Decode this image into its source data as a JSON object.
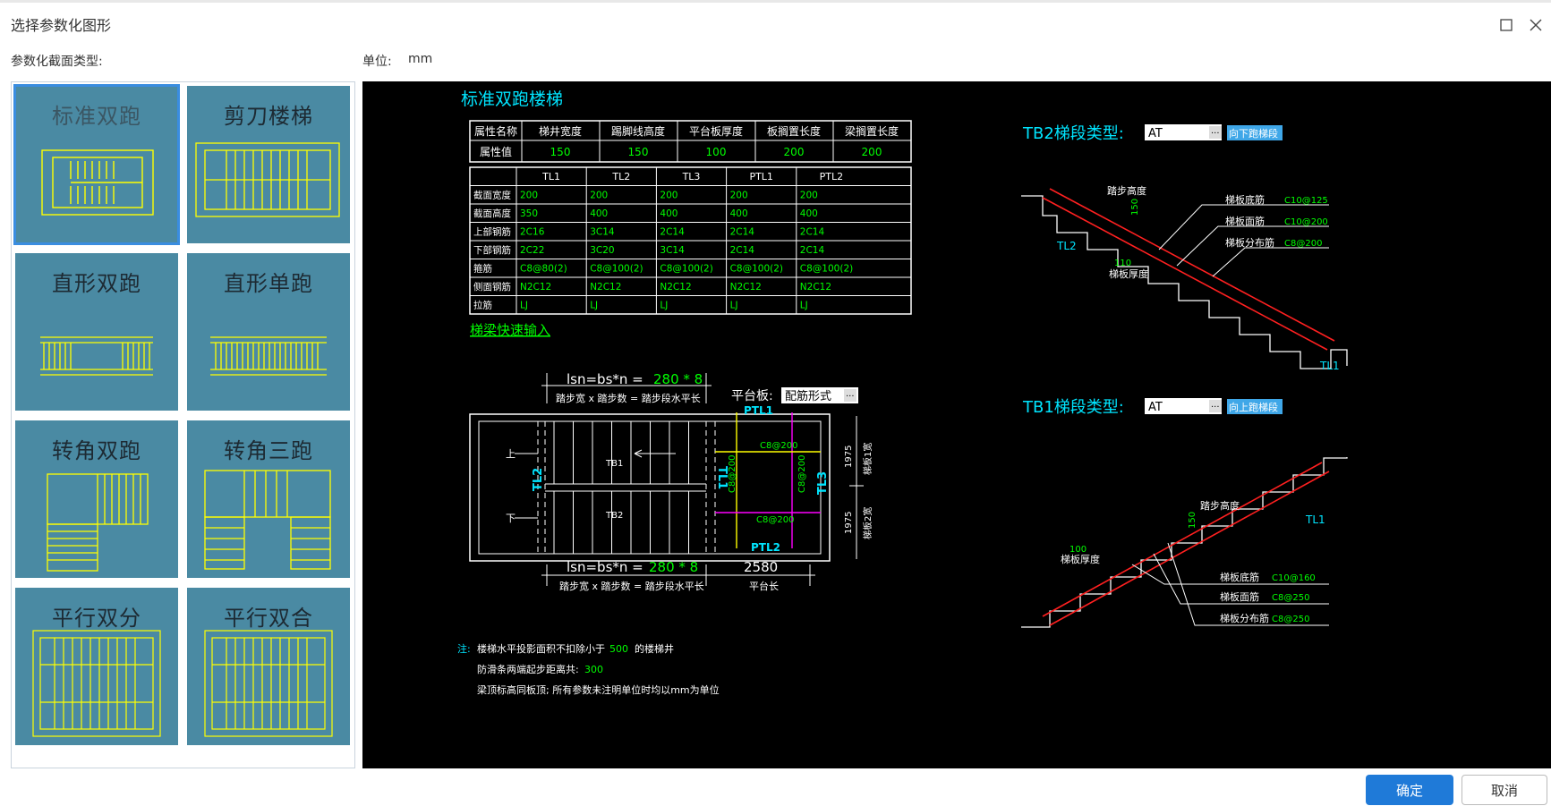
{
  "dialog": {
    "title": "选择参数化图形",
    "section_label": "参数化截面类型:",
    "unit_label": "单位:",
    "unit_value": "mm",
    "ok_label": "确定",
    "cancel_label": "取消"
  },
  "thumbnails": [
    {
      "label": "标准双跑",
      "selected": true
    },
    {
      "label": "剪刀楼梯"
    },
    {
      "label": "直形双跑"
    },
    {
      "label": "直形单跑"
    },
    {
      "label": "转角双跑"
    },
    {
      "label": "转角三跑"
    },
    {
      "label": "平行双分"
    },
    {
      "label": "平行双合"
    }
  ],
  "drawing": {
    "title": "标准双跑楼梯",
    "props": {
      "headers": [
        "属性名称",
        "梯井宽度",
        "踢脚线高度",
        "平台板厚度",
        "板搁置长度",
        "梁搁置长度"
      ],
      "row_label": "属性值",
      "values": [
        "150",
        "150",
        "100",
        "200",
        "200"
      ]
    },
    "beams": {
      "headers": [
        "",
        "TL1",
        "TL2",
        "TL3",
        "PTL1",
        "PTL2"
      ],
      "rows": [
        [
          "截面宽度",
          "200",
          "200",
          "200",
          "200",
          "200"
        ],
        [
          "截面高度",
          "350",
          "400",
          "400",
          "400",
          "400"
        ],
        [
          "上部钢筋",
          "2C16",
          "3C14",
          "2C14",
          "2C14",
          "2C14"
        ],
        [
          "下部钢筋",
          "2C22",
          "3C20",
          "3C14",
          "2C14",
          "2C14"
        ],
        [
          "箍筋",
          "C8@80(2)",
          "C8@100(2)",
          "C8@100(2)",
          "C8@100(2)",
          "C8@100(2)"
        ],
        [
          "侧面钢筋",
          "N2C12",
          "N2C12",
          "N2C12",
          "N2C12",
          "N2C12"
        ],
        [
          "拉筋",
          "LJ",
          "LJ",
          "LJ",
          "LJ",
          "LJ"
        ]
      ]
    },
    "quick_input_link": "梯梁快速输入",
    "plan": {
      "top_formula_prefix": "lsn=bs*n = ",
      "top_formula_value": "280 * 8",
      "top_formula_desc": "踏步宽 x 踏步数 = 踏步段水平长",
      "bottom_formula_prefix": "lsn=bs*n = ",
      "bottom_formula_value": "280 * 8",
      "bottom_formula_desc": "踏步宽 x 踏步数 = 踏步段水平长",
      "platform_length": "2580",
      "platform_length_label": "平台长",
      "platform_board_label": "平台板:",
      "platform_board_value": "配筋形式",
      "up_label": "上",
      "down_label": "下",
      "tb1": "TB1",
      "tb2": "TB2",
      "tl1": "TL1",
      "tl2": "TL2",
      "tl3": "TL3",
      "ptl1": "PTL1",
      "ptl2": "PTL2",
      "rebar_top": "C8@200",
      "rebar_bottom": "C8@200",
      "rebar_left": "C8@200",
      "rebar_right": "C8@200",
      "width1_value": "1975",
      "width1_label": "梯板1宽",
      "width2_value": "1975",
      "width2_label": "梯板2宽"
    },
    "notes": {
      "prefix": "注:",
      "line1_a": "楼梯水平投影面积不扣除小于",
      "line1_value": "500",
      "line1_b": "的楼梯井",
      "line2_a": "防滑条两端起步距离共:",
      "line2_value": "300",
      "line3": "梁顶标高同板顶; 所有参数未注明单位时均以mm为单位"
    },
    "tb2": {
      "label": "TB2梯段类型:",
      "type_value": "AT",
      "badge": "向下跑梯段",
      "step_height_label": "踏步高度",
      "step_height_value": "150",
      "thickness_label": "梯板厚度",
      "thickness_value": "110",
      "left_beam": "TL2",
      "right_beam": "TL1",
      "bottom_rebar_label": "梯板底筋",
      "bottom_rebar_value": "C10@125",
      "top_rebar_label": "梯板面筋",
      "top_rebar_value": "C10@200",
      "dist_rebar_label": "梯板分布筋",
      "dist_rebar_value": "C8@200"
    },
    "tb1": {
      "label": "TB1梯段类型:",
      "type_value": "AT",
      "badge": "向上跑梯段",
      "step_height_label": "踏步高度",
      "step_height_value": "150",
      "thickness_label": "梯板厚度",
      "thickness_value": "100",
      "right_beam": "TL1",
      "bottom_rebar_label": "梯板底筋",
      "bottom_rebar_value": "C10@160",
      "top_rebar_label": "梯板面筋",
      "top_rebar_value": "C8@250",
      "dist_rebar_label": "梯板分布筋",
      "dist_rebar_value": "C8@250"
    },
    "colors": {
      "line": "#ffffff",
      "value": "#00ff00",
      "title": "#00e5ff",
      "highlight": "#ffff00",
      "magenta": "#ff00ff",
      "rebar": "#ff2020",
      "badge": "#3fa7e8"
    }
  }
}
